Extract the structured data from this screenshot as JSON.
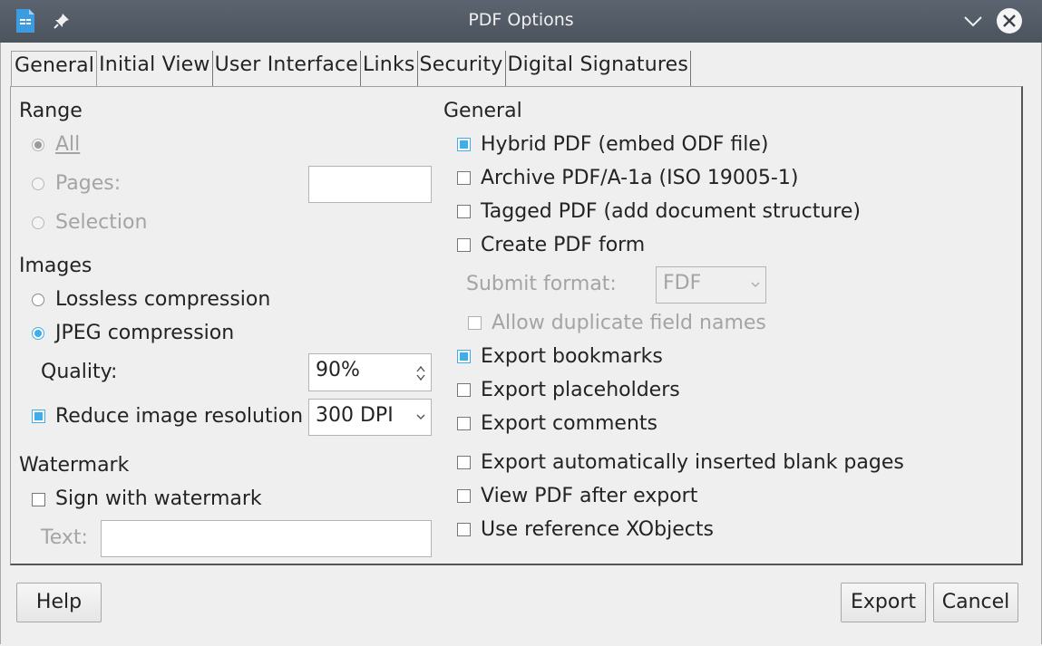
{
  "window": {
    "title": "PDF Options"
  },
  "tabs": [
    "General",
    "Initial View",
    "User Interface",
    "Links",
    "Security",
    "Digital Signatures"
  ],
  "range": {
    "heading": "Range",
    "all": "All",
    "pages": "Pages:",
    "selection": "Selection",
    "pages_value": ""
  },
  "images": {
    "heading": "Images",
    "lossless": "Lossless compression",
    "jpeg": "JPEG compression",
    "quality_label": "Quality:",
    "quality_value": "90%",
    "reduce": "Reduce image resolution",
    "resolution_value": "300 DPI"
  },
  "watermark": {
    "heading": "Watermark",
    "sign": "Sign with watermark",
    "text_label": "Text:",
    "text_value": ""
  },
  "general": {
    "heading": "General",
    "hybrid": "Hybrid PDF (embed ODF file)",
    "archive": "Archive PDF/A-1a (ISO 19005-1)",
    "tagged": "Tagged PDF (add document structure)",
    "create_form": "Create PDF form",
    "submit_label": "Submit format:",
    "submit_value": "FDF",
    "allow_dup": "Allow duplicate field names",
    "bookmarks": "Export bookmarks",
    "placeholders": "Export placeholders",
    "comments": "Export comments",
    "blank_pages": "Export automatically inserted blank pages",
    "view_after": "View PDF after export",
    "xobjects": "Use reference XObjects"
  },
  "buttons": {
    "help": "Help",
    "export": "Export",
    "cancel": "Cancel"
  },
  "colors": {
    "accent": "#3daee9",
    "titlebar": "#4f5761"
  }
}
